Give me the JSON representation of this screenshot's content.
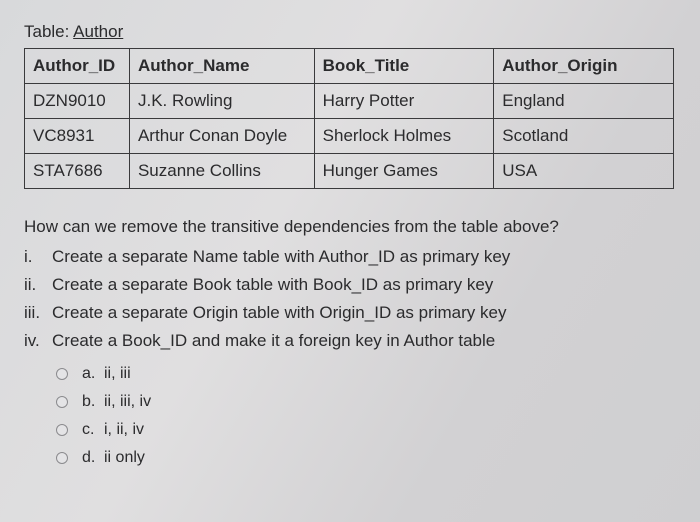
{
  "table_label_prefix": "Table: ",
  "table_name": "Author",
  "columns": [
    "Author_ID",
    "Author_Name",
    "Book_Title",
    "Author_Origin"
  ],
  "rows": [
    {
      "id": "DZN9010",
      "name": "J.K. Rowling",
      "book": "Harry Potter",
      "origin": "England"
    },
    {
      "id": "VC8931",
      "name": "Arthur Conan Doyle",
      "book": "Sherlock Holmes",
      "origin": "Scotland"
    },
    {
      "id": "STA7686",
      "name": "Suzanne Collins",
      "book": "Hunger Games",
      "origin": "USA"
    }
  ],
  "question": "How can we remove the transitive dependencies from the table above?",
  "stems": [
    {
      "num": "i.",
      "text": "Create a separate Name table with Author_ID as primary key"
    },
    {
      "num": "ii.",
      "text": "Create a separate Book table with Book_ID as primary key"
    },
    {
      "num": "iii.",
      "text": "Create a separate Origin table with Origin_ID as primary key"
    },
    {
      "num": "iv.",
      "text": "Create a Book_ID and make it a foreign key in Author table"
    }
  ],
  "options": [
    {
      "letter": "a.",
      "text": "ii, iii"
    },
    {
      "letter": "b.",
      "text": "ii, iii, iv"
    },
    {
      "letter": "c.",
      "text": "i, ii, iv"
    },
    {
      "letter": "d.",
      "text": "ii only"
    }
  ]
}
